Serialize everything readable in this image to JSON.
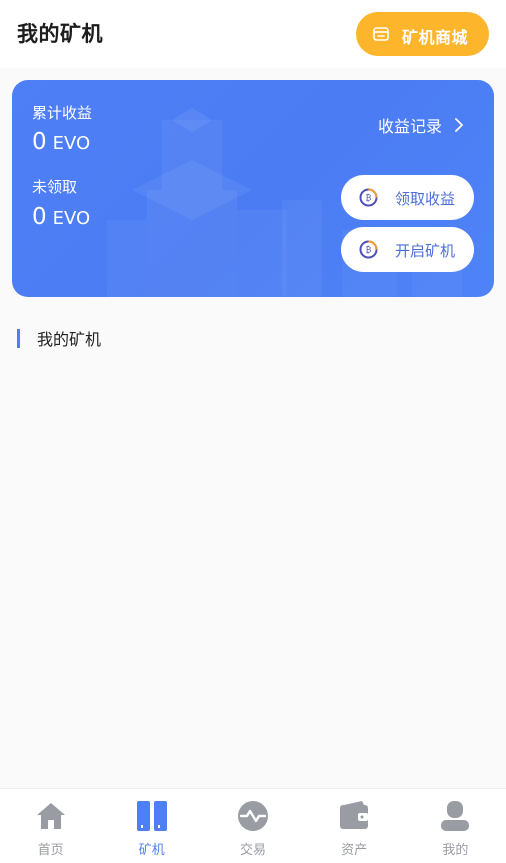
{
  "header": {
    "title": "我的矿机",
    "shop_button_label": "矿机商城"
  },
  "card": {
    "total_label": "累计收益",
    "total_value": "0",
    "total_unit": "EVO",
    "pending_label": "未领取",
    "pending_value": "0",
    "pending_unit": "EVO",
    "records_label": "收益记录",
    "claim_label": "领取收益",
    "start_label": "开启矿机"
  },
  "section": {
    "title": "我的矿机"
  },
  "nav": {
    "items": [
      {
        "label": "首页",
        "icon": "home-icon"
      },
      {
        "label": "矿机",
        "icon": "miner-icon",
        "active": true
      },
      {
        "label": "交易",
        "icon": "trade-icon"
      },
      {
        "label": "资产",
        "icon": "wallet-icon"
      },
      {
        "label": "我的",
        "icon": "user-icon"
      }
    ]
  },
  "colors": {
    "accent": "#4f7ff6",
    "shop_button": "#fdb52b",
    "inactive": "#9a9ca3"
  }
}
